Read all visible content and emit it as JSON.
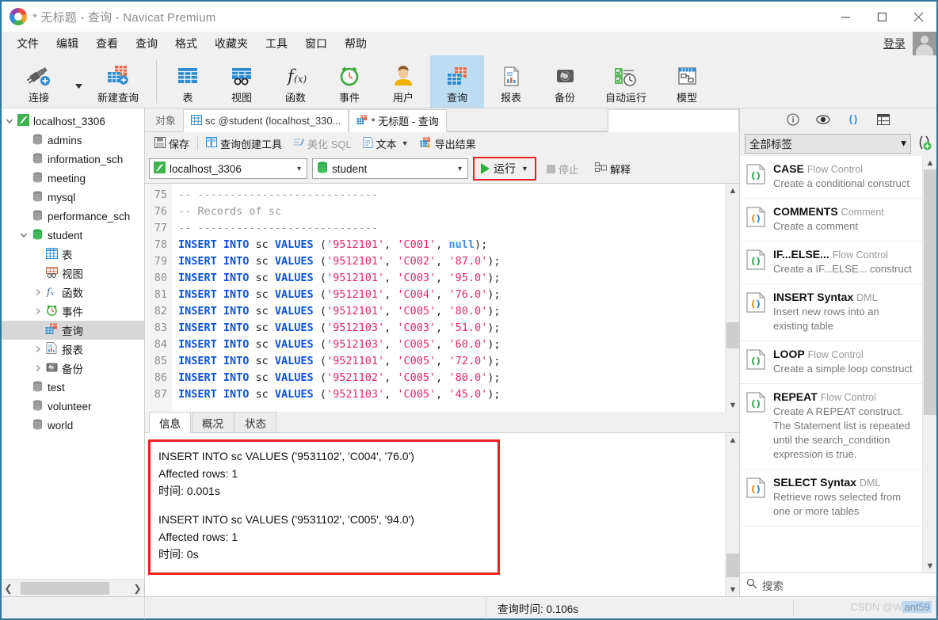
{
  "window": {
    "title": "* 无标题 - 查询 - Navicat Premium",
    "minimize": "minimize-button",
    "maximize": "maximize-button",
    "close": "close-button"
  },
  "menubar": {
    "items": [
      "文件",
      "编辑",
      "查看",
      "查询",
      "格式",
      "收藏夹",
      "工具",
      "窗口",
      "帮助"
    ],
    "login_label": "登录"
  },
  "ribbon": {
    "items": [
      {
        "label": "连接",
        "icon": "connection-icon",
        "active": false
      },
      {
        "label": "新建查询",
        "icon": "new-query-icon",
        "active": false
      },
      {
        "label": "表",
        "icon": "table-icon",
        "active": false
      },
      {
        "label": "视图",
        "icon": "view-icon",
        "active": false
      },
      {
        "label": "函数",
        "icon": "function-icon",
        "active": false
      },
      {
        "label": "事件",
        "icon": "event-icon",
        "active": false
      },
      {
        "label": "用户",
        "icon": "user-icon",
        "active": false
      },
      {
        "label": "查询",
        "icon": "query-icon",
        "active": true
      },
      {
        "label": "报表",
        "icon": "report-icon",
        "active": false
      },
      {
        "label": "备份",
        "icon": "backup-icon",
        "active": false
      },
      {
        "label": "自动运行",
        "icon": "automation-icon",
        "active": false
      },
      {
        "label": "模型",
        "icon": "model-icon",
        "active": false
      }
    ]
  },
  "sidebar": {
    "nodes": [
      {
        "label": "localhost_3306",
        "icon": "server-icon",
        "twisty": "expanded",
        "indent": 0,
        "selected": false
      },
      {
        "label": "admins",
        "icon": "database-gray-icon",
        "twisty": "",
        "indent": 1,
        "selected": false
      },
      {
        "label": "information_sch",
        "icon": "database-gray-icon",
        "twisty": "",
        "indent": 1,
        "selected": false
      },
      {
        "label": "meeting",
        "icon": "database-gray-icon",
        "twisty": "",
        "indent": 1,
        "selected": false
      },
      {
        "label": "mysql",
        "icon": "database-gray-icon",
        "twisty": "",
        "indent": 1,
        "selected": false
      },
      {
        "label": "performance_sch",
        "icon": "database-gray-icon",
        "twisty": "",
        "indent": 1,
        "selected": false
      },
      {
        "label": "student",
        "icon": "database-green-icon",
        "twisty": "expanded",
        "indent": 1,
        "selected": false
      },
      {
        "label": "表",
        "icon": "table-icon",
        "twisty": "",
        "indent": 2,
        "selected": false
      },
      {
        "label": "视图",
        "icon": "view-icon",
        "twisty": "",
        "indent": 2,
        "selected": false
      },
      {
        "label": "函数",
        "icon": "function-icon",
        "twisty": "collapsed",
        "indent": 2,
        "selected": false
      },
      {
        "label": "事件",
        "icon": "event-icon",
        "twisty": "collapsed",
        "indent": 2,
        "selected": false
      },
      {
        "label": "查询",
        "icon": "query-icon",
        "twisty": "",
        "indent": 2,
        "selected": true
      },
      {
        "label": "报表",
        "icon": "report-icon",
        "twisty": "collapsed",
        "indent": 2,
        "selected": false
      },
      {
        "label": "备份",
        "icon": "backup-icon",
        "twisty": "collapsed",
        "indent": 2,
        "selected": false
      },
      {
        "label": "test",
        "icon": "database-gray-icon",
        "twisty": "",
        "indent": 1,
        "selected": false
      },
      {
        "label": "volunteer",
        "icon": "database-gray-icon",
        "twisty": "",
        "indent": 1,
        "selected": false
      },
      {
        "label": "world",
        "icon": "database-gray-icon",
        "twisty": "",
        "indent": 1,
        "selected": false
      }
    ]
  },
  "tabs": {
    "object_tab": "对象",
    "table_tab": "sc @student (localhost_330...",
    "query_tab": "* 无标题 - 查询"
  },
  "editor_toolbar": {
    "save": "保存",
    "query_builder": "查询创建工具",
    "beautify_sql": "美化 SQL",
    "text": "文本",
    "export_result": "导出结果"
  },
  "runbar": {
    "connection": "localhost_3306",
    "database": "student",
    "run": "运行",
    "stop": "停止",
    "explain": "解释"
  },
  "editor": {
    "first_line": 75,
    "lines": [
      {
        "no": 75,
        "tokens": [
          {
            "t": "-- ----------------------------",
            "c": "c"
          }
        ]
      },
      {
        "no": 76,
        "tokens": [
          {
            "t": "-- Records of sc",
            "c": "c"
          }
        ]
      },
      {
        "no": 77,
        "tokens": [
          {
            "t": "-- ----------------------------",
            "c": "c"
          }
        ]
      },
      {
        "no": 78,
        "tokens": [
          {
            "t": "INSERT INTO",
            "c": "k"
          },
          {
            "t": " sc ",
            "c": "p"
          },
          {
            "t": "VALUES",
            "c": "k"
          },
          {
            "t": " (",
            "c": "p"
          },
          {
            "t": "'9512101'",
            "c": "s"
          },
          {
            "t": ", ",
            "c": "p"
          },
          {
            "t": "'C001'",
            "c": "s"
          },
          {
            "t": ", ",
            "c": "p"
          },
          {
            "t": "null",
            "c": "n"
          },
          {
            "t": ");",
            "c": "p"
          }
        ]
      },
      {
        "no": 79,
        "tokens": [
          {
            "t": "INSERT INTO",
            "c": "k"
          },
          {
            "t": " sc ",
            "c": "p"
          },
          {
            "t": "VALUES",
            "c": "k"
          },
          {
            "t": " (",
            "c": "p"
          },
          {
            "t": "'9512101'",
            "c": "s"
          },
          {
            "t": ", ",
            "c": "p"
          },
          {
            "t": "'C002'",
            "c": "s"
          },
          {
            "t": ", ",
            "c": "p"
          },
          {
            "t": "'87.0'",
            "c": "s"
          },
          {
            "t": ");",
            "c": "p"
          }
        ]
      },
      {
        "no": 80,
        "tokens": [
          {
            "t": "INSERT INTO",
            "c": "k"
          },
          {
            "t": " sc ",
            "c": "p"
          },
          {
            "t": "VALUES",
            "c": "k"
          },
          {
            "t": " (",
            "c": "p"
          },
          {
            "t": "'9512101'",
            "c": "s"
          },
          {
            "t": ", ",
            "c": "p"
          },
          {
            "t": "'C003'",
            "c": "s"
          },
          {
            "t": ", ",
            "c": "p"
          },
          {
            "t": "'95.0'",
            "c": "s"
          },
          {
            "t": ");",
            "c": "p"
          }
        ]
      },
      {
        "no": 81,
        "tokens": [
          {
            "t": "INSERT INTO",
            "c": "k"
          },
          {
            "t": " sc ",
            "c": "p"
          },
          {
            "t": "VALUES",
            "c": "k"
          },
          {
            "t": " (",
            "c": "p"
          },
          {
            "t": "'9512101'",
            "c": "s"
          },
          {
            "t": ", ",
            "c": "p"
          },
          {
            "t": "'C004'",
            "c": "s"
          },
          {
            "t": ", ",
            "c": "p"
          },
          {
            "t": "'76.0'",
            "c": "s"
          },
          {
            "t": ");",
            "c": "p"
          }
        ]
      },
      {
        "no": 82,
        "tokens": [
          {
            "t": "INSERT INTO",
            "c": "k"
          },
          {
            "t": " sc ",
            "c": "p"
          },
          {
            "t": "VALUES",
            "c": "k"
          },
          {
            "t": " (",
            "c": "p"
          },
          {
            "t": "'9512101'",
            "c": "s"
          },
          {
            "t": ", ",
            "c": "p"
          },
          {
            "t": "'C005'",
            "c": "s"
          },
          {
            "t": ", ",
            "c": "p"
          },
          {
            "t": "'80.0'",
            "c": "s"
          },
          {
            "t": ");",
            "c": "p"
          }
        ]
      },
      {
        "no": 83,
        "tokens": [
          {
            "t": "INSERT INTO",
            "c": "k"
          },
          {
            "t": " sc ",
            "c": "p"
          },
          {
            "t": "VALUES",
            "c": "k"
          },
          {
            "t": " (",
            "c": "p"
          },
          {
            "t": "'9512103'",
            "c": "s"
          },
          {
            "t": ", ",
            "c": "p"
          },
          {
            "t": "'C003'",
            "c": "s"
          },
          {
            "t": ", ",
            "c": "p"
          },
          {
            "t": "'51.0'",
            "c": "s"
          },
          {
            "t": ");",
            "c": "p"
          }
        ]
      },
      {
        "no": 84,
        "tokens": [
          {
            "t": "INSERT INTO",
            "c": "k"
          },
          {
            "t": " sc ",
            "c": "p"
          },
          {
            "t": "VALUES",
            "c": "k"
          },
          {
            "t": " (",
            "c": "p"
          },
          {
            "t": "'9512103'",
            "c": "s"
          },
          {
            "t": ", ",
            "c": "p"
          },
          {
            "t": "'C005'",
            "c": "s"
          },
          {
            "t": ", ",
            "c": "p"
          },
          {
            "t": "'60.0'",
            "c": "s"
          },
          {
            "t": ");",
            "c": "p"
          }
        ]
      },
      {
        "no": 85,
        "tokens": [
          {
            "t": "INSERT INTO",
            "c": "k"
          },
          {
            "t": " sc ",
            "c": "p"
          },
          {
            "t": "VALUES",
            "c": "k"
          },
          {
            "t": " (",
            "c": "p"
          },
          {
            "t": "'9521101'",
            "c": "s"
          },
          {
            "t": ", ",
            "c": "p"
          },
          {
            "t": "'C005'",
            "c": "s"
          },
          {
            "t": ", ",
            "c": "p"
          },
          {
            "t": "'72.0'",
            "c": "s"
          },
          {
            "t": ");",
            "c": "p"
          }
        ]
      },
      {
        "no": 86,
        "tokens": [
          {
            "t": "INSERT INTO",
            "c": "k"
          },
          {
            "t": " sc ",
            "c": "p"
          },
          {
            "t": "VALUES",
            "c": "k"
          },
          {
            "t": " (",
            "c": "p"
          },
          {
            "t": "'9521102'",
            "c": "s"
          },
          {
            "t": ", ",
            "c": "p"
          },
          {
            "t": "'C005'",
            "c": "s"
          },
          {
            "t": ", ",
            "c": "p"
          },
          {
            "t": "'80.0'",
            "c": "s"
          },
          {
            "t": ");",
            "c": "p"
          }
        ]
      },
      {
        "no": 87,
        "tokens": [
          {
            "t": "INSERT INTO",
            "c": "k"
          },
          {
            "t": " sc ",
            "c": "p"
          },
          {
            "t": "VALUES",
            "c": "k"
          },
          {
            "t": " (",
            "c": "p"
          },
          {
            "t": "'9521103'",
            "c": "s"
          },
          {
            "t": ", ",
            "c": "p"
          },
          {
            "t": "'C005'",
            "c": "s"
          },
          {
            "t": ", ",
            "c": "p"
          },
          {
            "t": "'45.0'",
            "c": "s"
          },
          {
            "t": ");",
            "c": "p"
          }
        ]
      }
    ]
  },
  "results": {
    "tabs": [
      "信息",
      "概况",
      "状态"
    ],
    "active_tab": "信息",
    "log": [
      "INSERT INTO sc VALUES ('9531102', 'C004', '76.0')",
      "Affected rows: 1",
      "时间: 0.001s",
      "",
      "INSERT INTO sc VALUES ('9531102', 'C005', '94.0')",
      "Affected rows: 1",
      "时间: 0s"
    ]
  },
  "snippets_panel": {
    "icons": [
      "info-icon",
      "eye-icon",
      "code-parens-icon",
      "grid-icon"
    ],
    "filter_value": "全部标签",
    "add_label": "add-snippet-icon",
    "search_placeholder": "搜索",
    "items": [
      {
        "name": "CASE",
        "category": "Flow Control",
        "desc": "Create a conditional construct",
        "icon_color": "#2fa84f"
      },
      {
        "name": "COMMENTS",
        "category": "Comment",
        "desc": "Create a comment",
        "icon_color": "#e08a1e"
      },
      {
        "name": "IF...ELSE...",
        "category": "Flow Control",
        "desc": "Create a IF...ELSE... construct",
        "icon_color": "#2fa84f"
      },
      {
        "name": "INSERT Syntax",
        "category": "DML",
        "desc": "Insert new rows into an existing table",
        "icon_color": "#e08a1e"
      },
      {
        "name": "LOOP",
        "category": "Flow Control",
        "desc": "Create a simple loop construct",
        "icon_color": "#2fa84f"
      },
      {
        "name": "REPEAT",
        "category": "Flow Control",
        "desc": "Create A REPEAT construct. The Statement list is repeated until the search_condition expression is true.",
        "icon_color": "#2fa84f"
      },
      {
        "name": "SELECT Syntax",
        "category": "DML",
        "desc": "Retrieve rows selected from one or more tables",
        "icon_color": "#e08a1e"
      }
    ]
  },
  "statusbar": {
    "query_time": "查询时间: 0.106s",
    "watermark": "CSDN @W",
    "watermark_box": "ant59"
  },
  "colors": {
    "accent_blue": "#2b7a9b",
    "highlight_red": "#ee2222",
    "ribbon_active": "#bcdcf2",
    "keyword": "#0d53d6",
    "string": "#e8286d",
    "comment": "#9a9a9a",
    "run_green": "#2fb03a"
  }
}
